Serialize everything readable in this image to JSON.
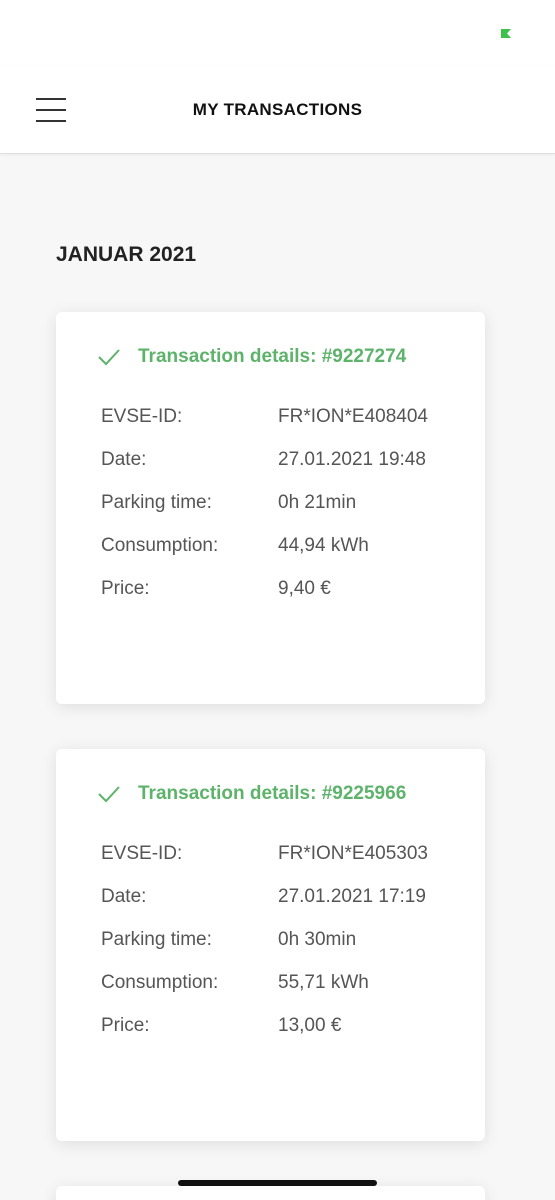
{
  "header": {
    "title": "MY TRANSACTIONS"
  },
  "month_heading": "JANUAR 2021",
  "colors": {
    "accent": "#5db36a",
    "battery": "#3cc24a"
  },
  "transactions": [
    {
      "title": "Transaction details: #9227274",
      "rows": [
        {
          "label": "EVSE-ID:",
          "value": "FR*ION*E408404"
        },
        {
          "label": "Date:",
          "value": "27.01.2021 19:48"
        },
        {
          "label": "Parking time:",
          "value": "0h 21min"
        },
        {
          "label": "Consumption:",
          "value": "44,94 kWh"
        },
        {
          "label": "Price:",
          "value": "9,40 €"
        }
      ]
    },
    {
      "title": "Transaction details: #9225966",
      "rows": [
        {
          "label": "EVSE-ID:",
          "value": "FR*ION*E405303"
        },
        {
          "label": "Date:",
          "value": "27.01.2021 17:19"
        },
        {
          "label": "Parking time:",
          "value": "0h 30min"
        },
        {
          "label": "Consumption:",
          "value": "55,71 kWh"
        },
        {
          "label": "Price:",
          "value": "13,00 €"
        }
      ]
    }
  ]
}
